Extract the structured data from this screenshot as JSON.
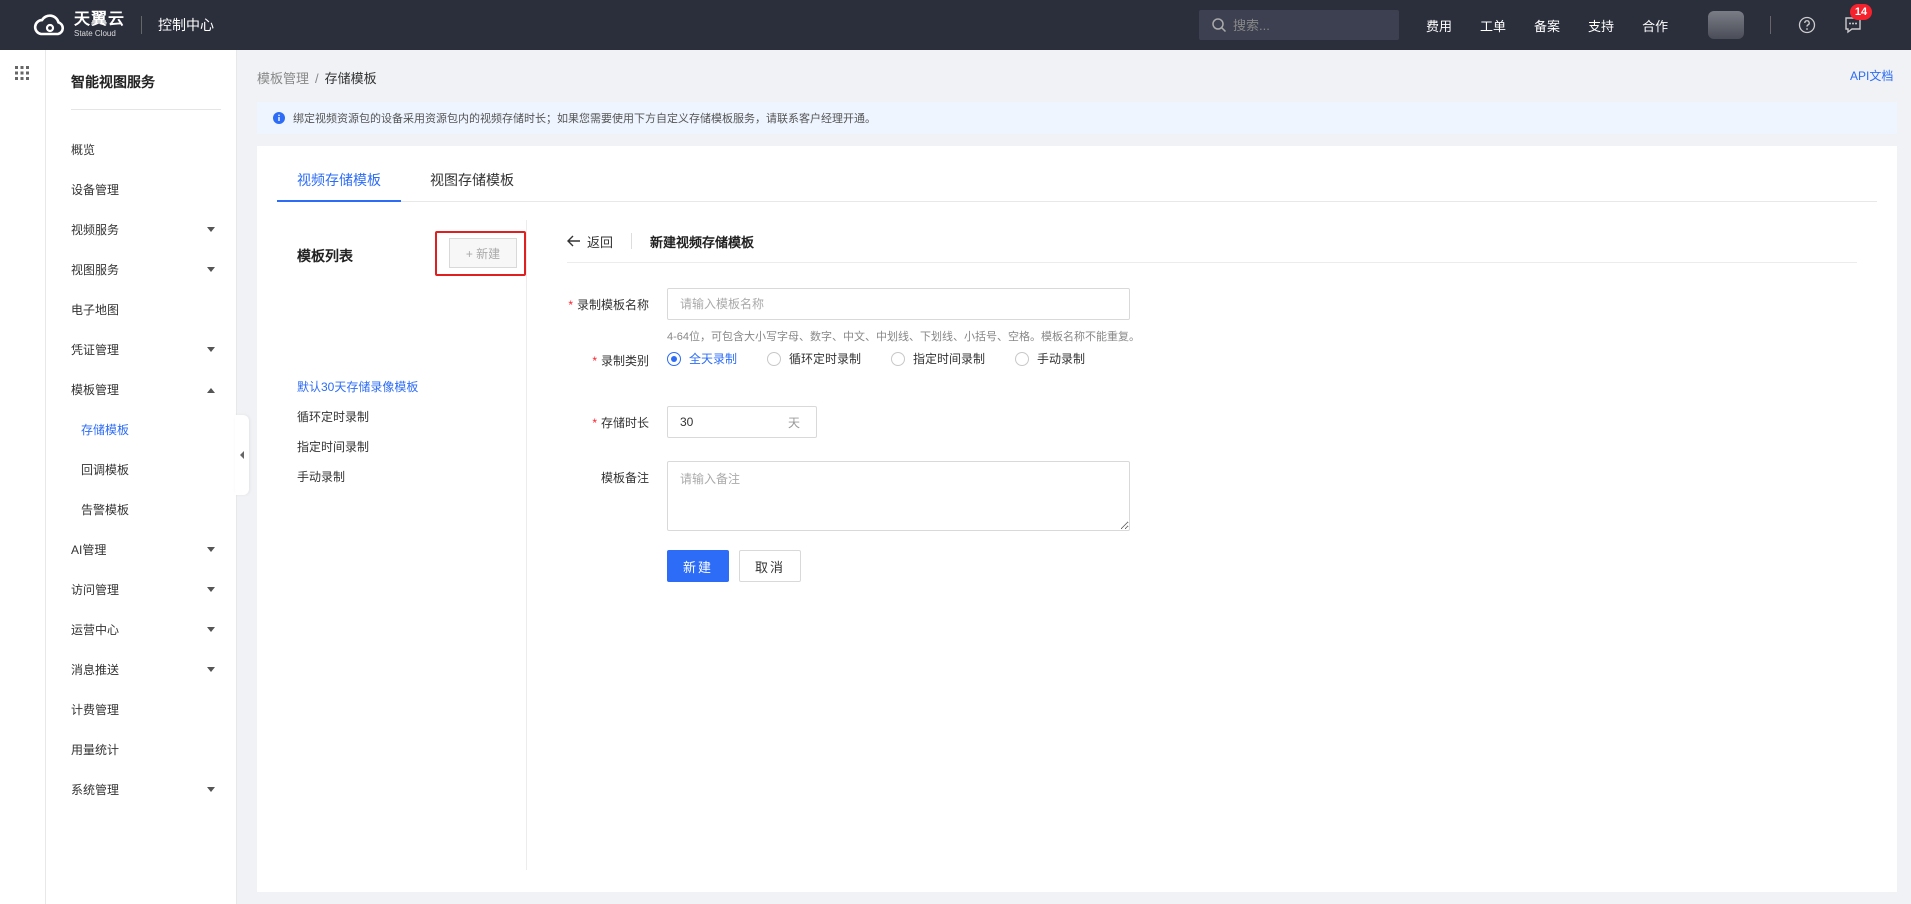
{
  "header": {
    "logo_zh": "天翼云",
    "logo_en": "State Cloud",
    "console_title": "控制中心",
    "search_placeholder": "搜索...",
    "nav": [
      "费用",
      "工单",
      "备案",
      "支持",
      "合作"
    ],
    "message_count": "14"
  },
  "sidebar": {
    "title": "智能视图服务",
    "items": [
      {
        "label": "概览",
        "caret": ""
      },
      {
        "label": "设备管理",
        "caret": ""
      },
      {
        "label": "视频服务",
        "caret": "down"
      },
      {
        "label": "视图服务",
        "caret": "down"
      },
      {
        "label": "电子地图",
        "caret": ""
      },
      {
        "label": "凭证管理",
        "caret": "down"
      },
      {
        "label": "模板管理",
        "caret": "up"
      },
      {
        "label": "存储模板",
        "sub": true,
        "active": true
      },
      {
        "label": "回调模板",
        "sub": true
      },
      {
        "label": "告警模板",
        "sub": true
      },
      {
        "label": "AI管理",
        "caret": "down"
      },
      {
        "label": "访问管理",
        "caret": "down"
      },
      {
        "label": "运营中心",
        "caret": "down"
      },
      {
        "label": "消息推送",
        "caret": "down"
      },
      {
        "label": "计费管理",
        "caret": ""
      },
      {
        "label": "用量统计",
        "caret": ""
      },
      {
        "label": "系统管理",
        "caret": "down"
      }
    ]
  },
  "breadcrumb": {
    "parent": "模板管理",
    "sep": "/",
    "current": "存储模板"
  },
  "api_doc": "API文档",
  "notice": "绑定视频资源包的设备采用资源包内的视频存储时长；如果您需要使用下方自定义存储模板服务，请联系客户经理开通。",
  "tabs": [
    {
      "label": "视频存储模板",
      "active": true
    },
    {
      "label": "视图存储模板",
      "active": false
    }
  ],
  "list": {
    "title": "模板列表",
    "new_button": "+ 新建",
    "items": [
      {
        "label": "默认30天存储录像模板",
        "active": true
      },
      {
        "label": "循环定时录制",
        "active": false
      },
      {
        "label": "指定时间录制",
        "active": false
      },
      {
        "label": "手动录制",
        "active": false
      }
    ]
  },
  "form": {
    "back": "返回",
    "title": "新建视频存储模板",
    "name_label": "录制模板名称",
    "name_placeholder": "请输入模板名称",
    "name_hint": "4-64位，可包含大小写字母、数字、中文、中划线、下划线、小括号、空格。模板名称不能重复。",
    "type_label": "录制类别",
    "types": [
      {
        "label": "全天录制",
        "checked": true
      },
      {
        "label": "循环定时录制",
        "checked": false
      },
      {
        "label": "指定时间录制",
        "checked": false
      },
      {
        "label": "手动录制",
        "checked": false
      }
    ],
    "duration_label": "存储时长",
    "duration_value": "30",
    "duration_unit": "天",
    "remark_label": "模板备注",
    "remark_placeholder": "请输入备注",
    "submit": "新建",
    "cancel": "取消"
  },
  "colors": {
    "accent": "#2d6cf6",
    "topbar": "#2b2e3b",
    "highlight_box": "#e02020"
  }
}
